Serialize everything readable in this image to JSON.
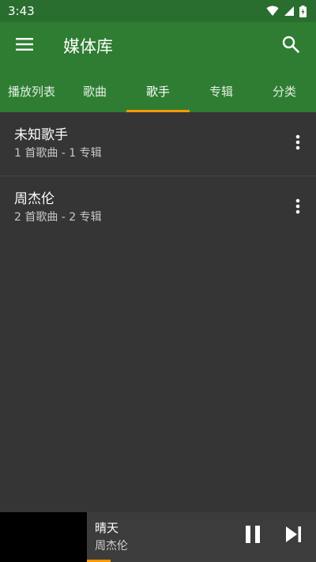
{
  "status_bar": {
    "time": "3:43",
    "icons": [
      "wifi-icon",
      "cell-signal-icon",
      "battery-charging-icon"
    ]
  },
  "app_bar": {
    "title": "媒体库",
    "menu_icon": "menu-icon",
    "search_icon": "search-icon"
  },
  "tabs": [
    {
      "label": "播放列表",
      "active": false
    },
    {
      "label": "歌曲",
      "active": false
    },
    {
      "label": "歌手",
      "active": true
    },
    {
      "label": "专辑",
      "active": false
    },
    {
      "label": "分类",
      "active": false
    }
  ],
  "artists": [
    {
      "name": "未知歌手",
      "summary": "1 首歌曲 - 1 专辑"
    },
    {
      "name": "周杰伦",
      "summary": "2 首歌曲 - 2 专辑"
    }
  ],
  "mini_player": {
    "song_title": "晴天",
    "artist": "周杰伦",
    "progress": 0.075
  },
  "colors": {
    "primary": "#2e7d32",
    "status_bar": "#2a6e2f",
    "accent": "#ff9800",
    "background": "#353535"
  }
}
